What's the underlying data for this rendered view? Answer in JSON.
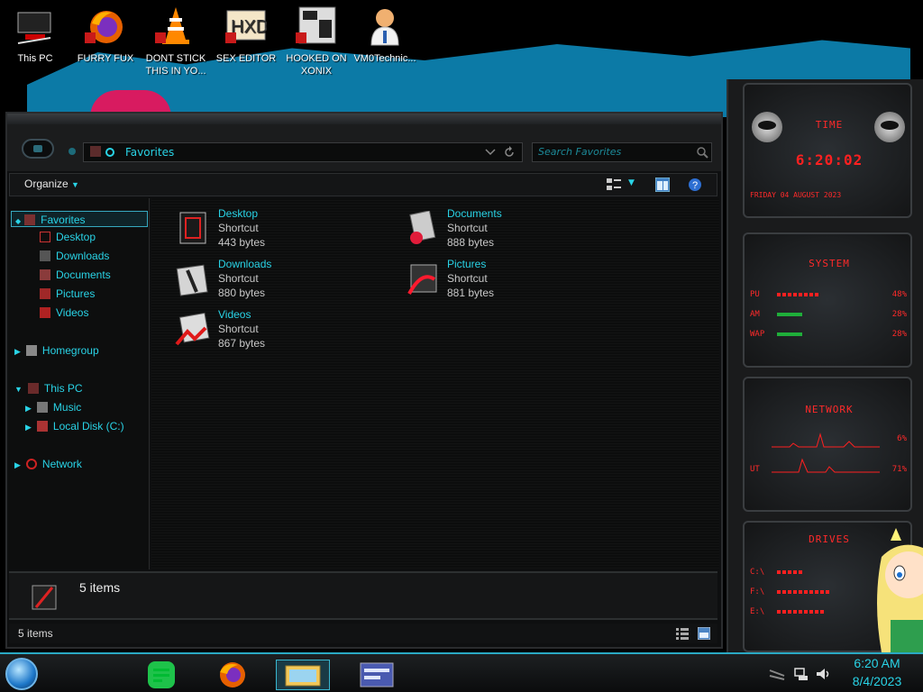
{
  "desktop_icons": [
    {
      "label": "This PC"
    },
    {
      "label": "FURRY FUX"
    },
    {
      "label": "DONT STICK THIS IN YO..."
    },
    {
      "label": "SEX EDITOR"
    },
    {
      "label": "HOOKED ON XONIX"
    },
    {
      "label": "VM0Technic..."
    }
  ],
  "explorer": {
    "address": "Favorites",
    "search_placeholder": "Search Favorites",
    "organize_label": "Organize",
    "nav": {
      "favorites": "Favorites",
      "desktop": "Desktop",
      "downloads": "Downloads",
      "documents": "Documents",
      "pictures": "Pictures",
      "videos": "Videos",
      "homegroup": "Homegroup",
      "this_pc": "This PC",
      "music": "Music",
      "local_disk": "Local Disk (C:)",
      "network": "Network"
    },
    "files": [
      {
        "name": "Desktop",
        "type": "Shortcut",
        "size": "443 bytes"
      },
      {
        "name": "Documents",
        "type": "Shortcut",
        "size": "888 bytes"
      },
      {
        "name": "Downloads",
        "type": "Shortcut",
        "size": "880 bytes"
      },
      {
        "name": "Pictures",
        "type": "Shortcut",
        "size": "881 bytes"
      },
      {
        "name": "Videos",
        "type": "Shortcut",
        "size": "867 bytes"
      }
    ],
    "details_count": "5 items",
    "status_count": "5 items"
  },
  "gadgets": {
    "time_title": "TIME",
    "time_value": "6:20:02",
    "date_value": "FRIDAY 04 AUGUST 2023",
    "system_title": "SYSTEM",
    "system_rows": [
      {
        "label": "PU",
        "pct": "48%",
        "fill": 0.48
      },
      {
        "label": "AM",
        "pct": "28%",
        "fill": 0.28
      },
      {
        "label": "WAP",
        "pct": "28%",
        "fill": 0.28
      }
    ],
    "network_title": "NETWORK",
    "network_rows": [
      {
        "label": "",
        "pct": "6%"
      },
      {
        "label": "UT",
        "pct": "71%"
      }
    ],
    "drives_title": "DRIVES",
    "drives_rows": [
      {
        "label": "C:\\"
      },
      {
        "label": "F:\\"
      },
      {
        "label": "E:\\"
      }
    ]
  },
  "taskbar": {
    "clock_time": "6:20 AM",
    "clock_date": "8/4/2023"
  },
  "colors": {
    "accent": "#29d3e6",
    "gadget_red": "#ff2020"
  }
}
